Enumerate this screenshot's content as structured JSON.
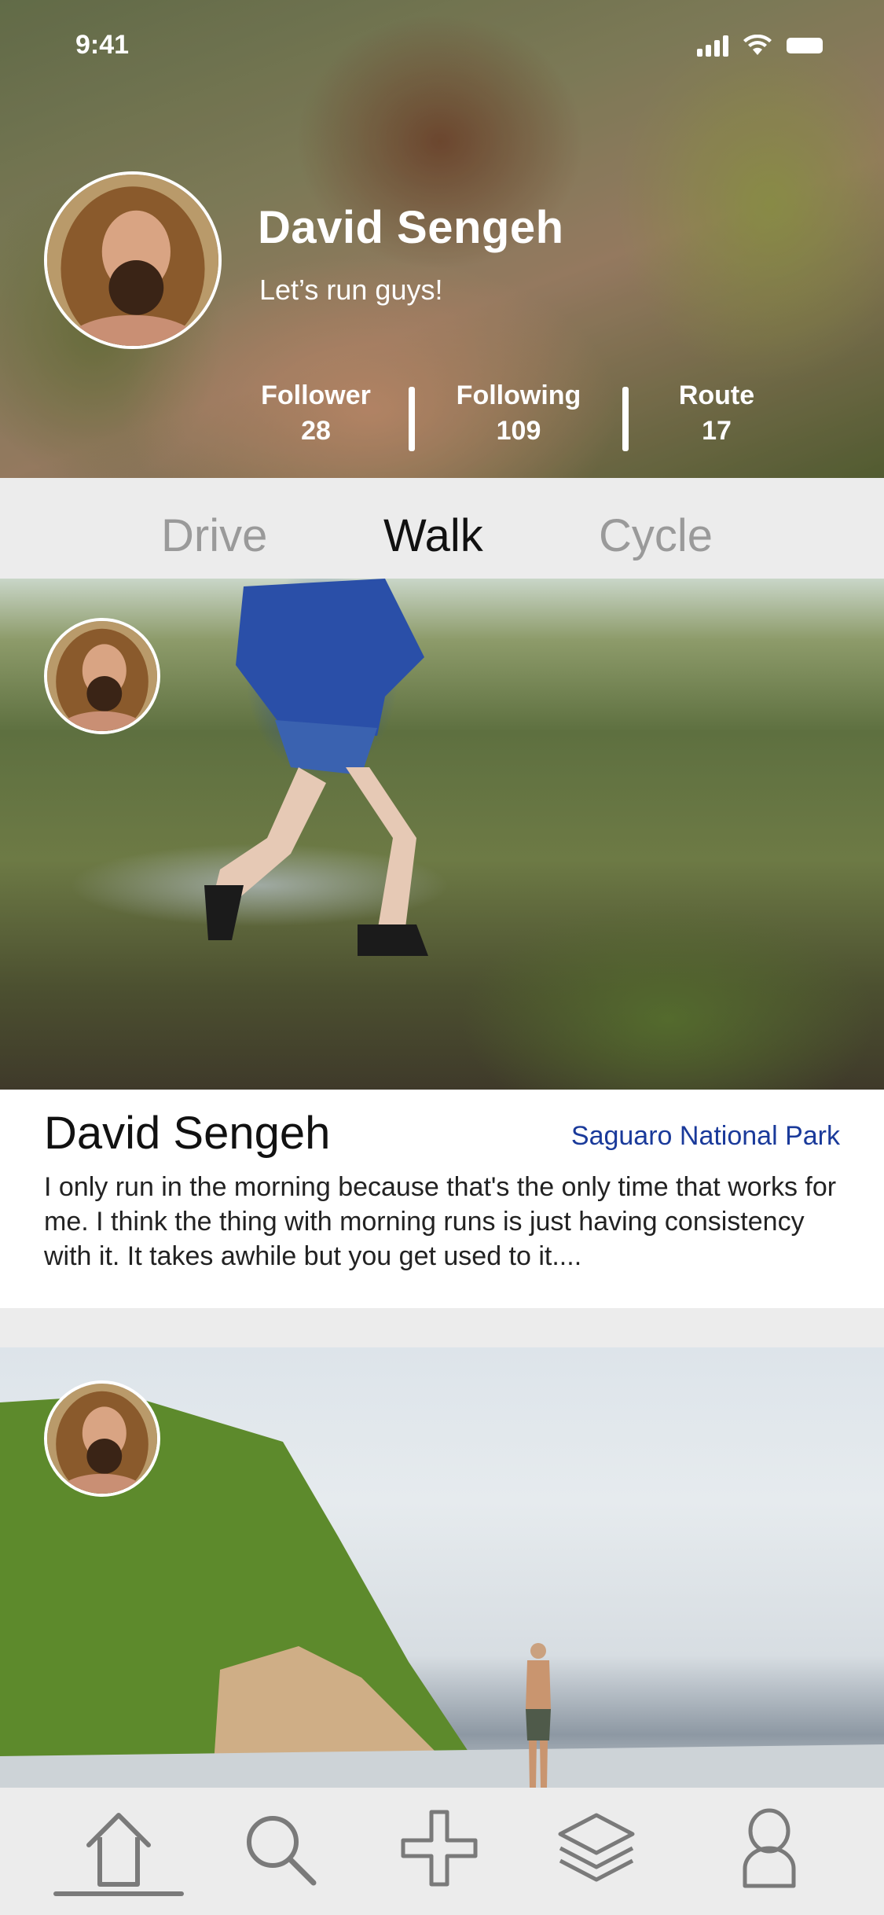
{
  "status_bar": {
    "time": "9:41"
  },
  "profile": {
    "name": "David Sengeh",
    "bio": "Let’s run guys!",
    "stats": [
      {
        "label": "Follower",
        "value": "28"
      },
      {
        "label": "Following",
        "value": "109"
      },
      {
        "label": "Route",
        "value": "17"
      }
    ]
  },
  "tabs": [
    {
      "label": "Drive",
      "active": false
    },
    {
      "label": "Walk",
      "active": true
    },
    {
      "label": "Cycle",
      "active": false
    }
  ],
  "posts": [
    {
      "author": "David Sengeh",
      "location": "Saguaro National Park",
      "text": "I only run in the morning because that's the only time that works for me. I think the thing with morning runs is just having consistency with it. It takes awhile but you get used to it...."
    }
  ],
  "bottom_nav": {
    "items": [
      "home-icon",
      "search-icon",
      "plus-icon",
      "layers-icon",
      "profile-icon"
    ],
    "active": "home-icon"
  },
  "colors": {
    "accent_link": "#1a3a9a",
    "tab_inactive": "#9a9a9a",
    "tab_active": "#111111",
    "nav_icon": "#7a7a7a"
  }
}
